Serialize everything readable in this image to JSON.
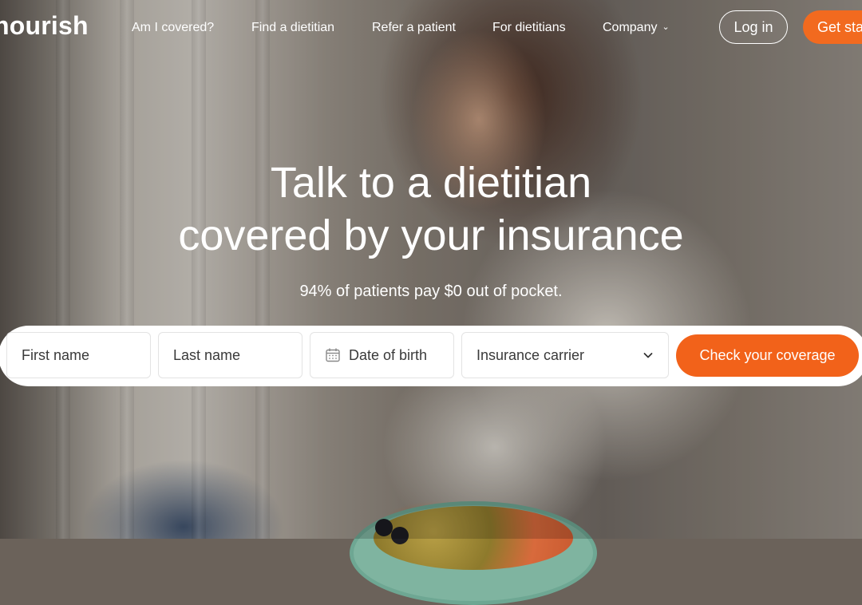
{
  "brand": {
    "logo_text": "nourish",
    "accent_color": "#f26a1f"
  },
  "nav": {
    "links": [
      {
        "label": "Am I covered?"
      },
      {
        "label": "Find a dietitian"
      },
      {
        "label": "Refer a patient"
      },
      {
        "label": "For dietitians"
      },
      {
        "label": "Company",
        "has_dropdown": true
      }
    ],
    "login_label": "Log in",
    "get_started_label": "Get started"
  },
  "hero": {
    "headline_line1": "Talk to a dietitian",
    "headline_line2": "covered by your insurance",
    "subheadline": "94% of patients pay $0 out of pocket."
  },
  "form": {
    "first_name_placeholder": "First name",
    "last_name_placeholder": "Last name",
    "dob_placeholder": "Date of birth",
    "carrier_label": "Insurance carrier",
    "submit_label": "Check your coverage"
  },
  "icons": {
    "calendar": "calendar-icon",
    "carrier_dropdown": "chevron-down-icon",
    "company_dropdown": "chevron-down-icon"
  }
}
